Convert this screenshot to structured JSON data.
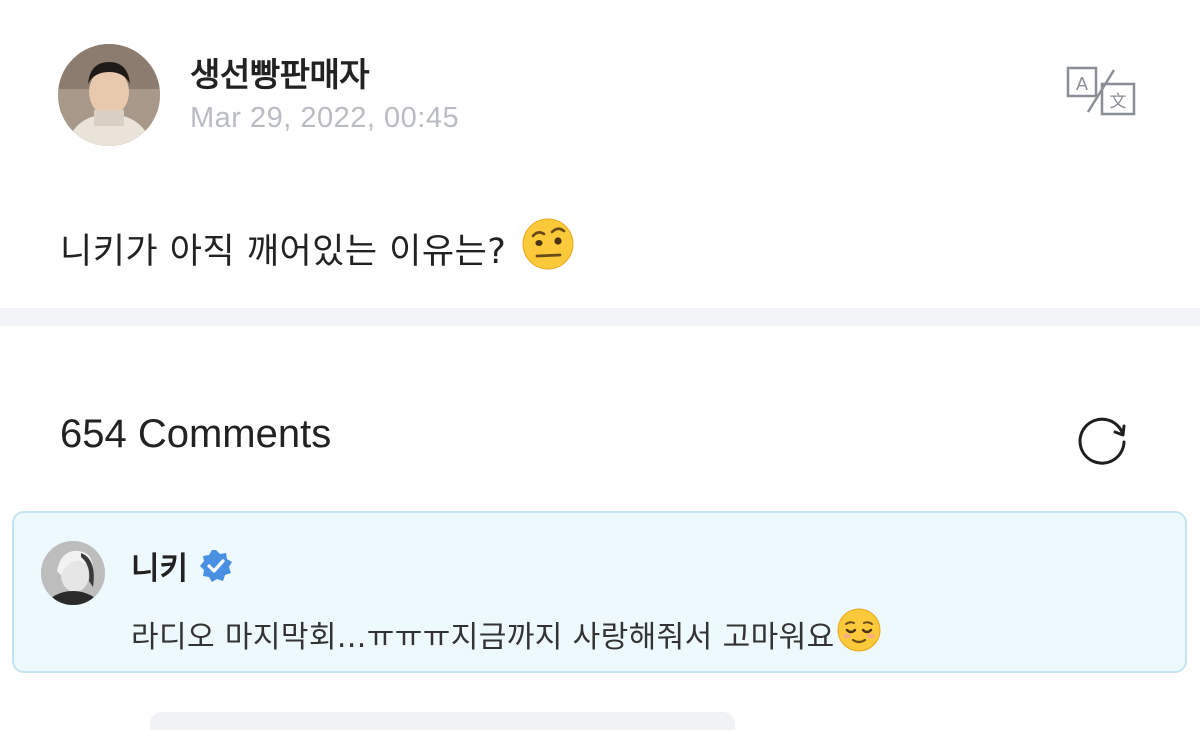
{
  "post": {
    "author_name": "생선빵판매자",
    "date": "Mar 29, 2022, 00:45",
    "text": "니키가 아직 깨어있는 이유는?",
    "emoji": "raised-eyebrow-emoji"
  },
  "header": {
    "translate_icon": "translate-icon"
  },
  "comments": {
    "count_label": "654 Comments",
    "refresh_icon": "refresh-icon",
    "items": [
      {
        "author": "니키",
        "verified": true,
        "text": "라디오 마지막회...ㅠㅠㅠ지금까지 사랑해줘서 고마워요",
        "emoji": "relieved-face-emoji"
      }
    ]
  },
  "colors": {
    "accent": "#4a90e2",
    "comment_bg": "#eef9fd",
    "comment_border": "#c5e4f2",
    "divider": "#f2f3f7",
    "date_text": "#b9bcc2"
  }
}
